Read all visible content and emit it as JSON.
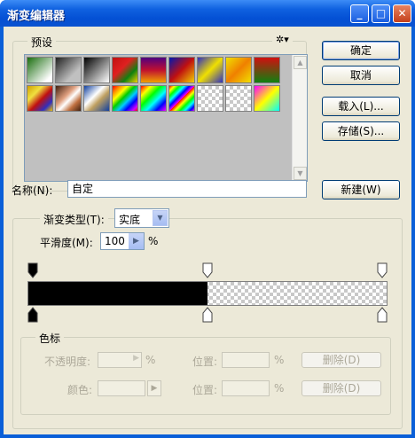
{
  "window": {
    "title": "渐变编辑器"
  },
  "title_buttons": {
    "minimize": "_",
    "maximize": "□",
    "close": "✕"
  },
  "presets": {
    "legend": "预设",
    "menu_icon": "gear-icon",
    "menu_glyph": "✲▾",
    "swatches": [
      "linear-gradient(135deg,#1b6e10 0%,#fff 85%)",
      "linear-gradient(135deg,#222 0%,rgba(0,0,0,0) 70%)",
      "linear-gradient(135deg,#000 0%,#fff 100%)",
      "linear-gradient(135deg,#c01010 0%,#e02020 40%,#108010 70%,#f0d000 100%)",
      "linear-gradient(180deg,#500080 0%,#c01030 50%,#f0a000 100%)",
      "linear-gradient(135deg,#0018b0 0%,#c01010 50%,#f0d000 100%)",
      "linear-gradient(135deg,#3030c0 0%,#f0e000 50%,#3030c0 100%)",
      "linear-gradient(135deg,#f0e000 0%,#f08000 50%,#f0e000 100%)",
      "linear-gradient(180deg,#d01010 0%,#108010 100%)",
      "linear-gradient(135deg,#d0a000 0%,#f0e040 30%,#c01010 55%,#3030c0 80%,#f0c000 100%)",
      "linear-gradient(135deg,#402010 0%,#e0a080 40%,#fff 55%,#c07040 75%,#402010 100%)",
      "linear-gradient(135deg,#1040a0 0%,#fff 40%,#c0a060 60%,#1040a0 100%)",
      "linear-gradient(135deg,#f00 0%,#f80 15%,#ff0 30%,#0c0 45%,#0cf 60%,#00f 75%,#c0f 90%,#f00 100%)",
      "linear-gradient(135deg,#f00 0%,#ff0 20%,#0f0 40%,#0ff 60%,#00f 80%,#f0f 100%)",
      "repeating-linear-gradient(135deg,#f00 0,#ff0 4px,#0f0 8px,#0ff 12px,#00f 16px,#f0f 20px)",
      "checker",
      "checker",
      "linear-gradient(135deg,#f0f 0%,#ff0 50%,#0ff 100%)"
    ]
  },
  "buttons": {
    "ok": "确定",
    "cancel": "取消",
    "load": "载入(L)...",
    "save": "存储(S)...",
    "new": "新建(W)"
  },
  "name": {
    "label": "名称(N):",
    "value": "自定"
  },
  "gradient_type": {
    "label": "渐变类型(T):",
    "value": "实底"
  },
  "smoothness": {
    "label": "平滑度(M):",
    "value": "100",
    "unit": "%"
  },
  "gradient": {
    "left_color": "#000000",
    "color_stop_fraction": 0.5,
    "opacity_stops": [
      0,
      0.5,
      1
    ],
    "color_stops": [
      0,
      0.5,
      1
    ]
  },
  "stops_panel": {
    "legend": "色标",
    "opacity_label": "不透明度:",
    "opacity_unit": "%",
    "location_label_1": "位置:",
    "location_unit_1": "%",
    "delete_label_1": "删除(D)",
    "color_label": "颜色:",
    "location_label_2": "位置:",
    "location_unit_2": "%",
    "delete_label_2": "删除(D)"
  }
}
